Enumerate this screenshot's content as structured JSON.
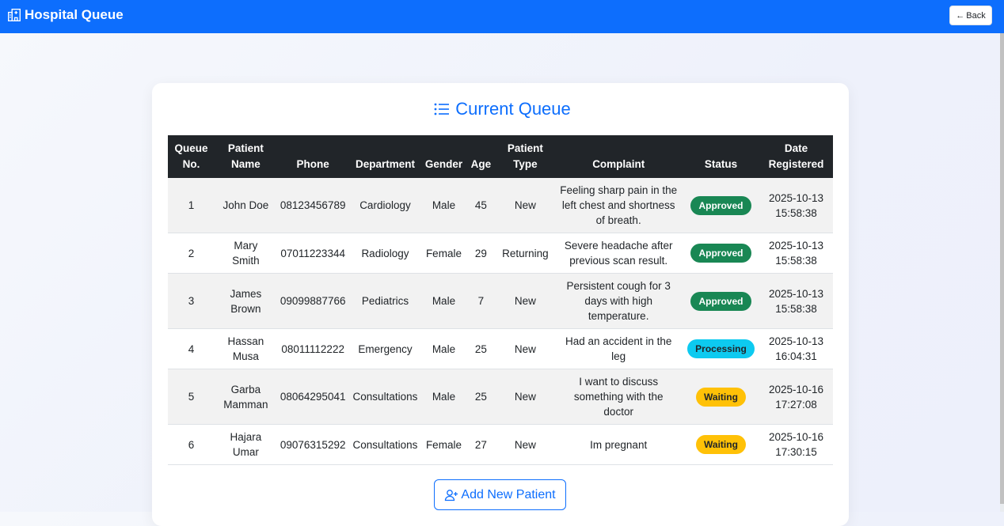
{
  "header": {
    "app_title": "Hospital Queue",
    "back_label": "Back",
    "background": "#0d6efd"
  },
  "main": {
    "title": "Current Queue",
    "add_button_label": "Add New Patient"
  },
  "table": {
    "columns": [
      [
        "Queue",
        "No."
      ],
      [
        "Patient",
        "Name"
      ],
      [
        "Phone"
      ],
      [
        "Department"
      ],
      [
        "Gender"
      ],
      [
        "Age"
      ],
      [
        "Patient",
        "Type"
      ],
      [
        "Complaint"
      ],
      [
        "Status"
      ],
      [
        "Date",
        "Registered"
      ]
    ],
    "rows": [
      {
        "queue_no": "1",
        "name": [
          "John Doe"
        ],
        "phone": "08123456789",
        "department": "Cardiology",
        "gender": "Male",
        "age": "45",
        "type": "New",
        "complaint": [
          "Feeling sharp pain in the",
          "left chest and shortness",
          "of breath."
        ],
        "status": "Approved",
        "date": "2025-10-13",
        "time": "15:58:38"
      },
      {
        "queue_no": "2",
        "name": [
          "Mary",
          "Smith"
        ],
        "phone": "07011223344",
        "department": "Radiology",
        "gender": "Female",
        "age": "29",
        "type": "Returning",
        "complaint": [
          "Severe headache after",
          "previous scan result."
        ],
        "status": "Approved",
        "date": "2025-10-13",
        "time": "15:58:38"
      },
      {
        "queue_no": "3",
        "name": [
          "James",
          "Brown"
        ],
        "phone": "09099887766",
        "department": "Pediatrics",
        "gender": "Male",
        "age": "7",
        "type": "New",
        "complaint": [
          "Persistent cough for 3",
          "days with high",
          "temperature."
        ],
        "status": "Approved",
        "date": "2025-10-13",
        "time": "15:58:38"
      },
      {
        "queue_no": "4",
        "name": [
          "Hassan",
          "Musa"
        ],
        "phone": "08011112222",
        "department": "Emergency",
        "gender": "Male",
        "age": "25",
        "type": "New",
        "complaint": [
          "Had an accident in the leg"
        ],
        "status": "Processing",
        "date": "2025-10-13",
        "time": "16:04:31"
      },
      {
        "queue_no": "5",
        "name": [
          "Garba",
          "Mamman"
        ],
        "phone": "08064295041",
        "department": "Consultations",
        "gender": "Male",
        "age": "25",
        "type": "New",
        "complaint": [
          "I want to discuss",
          "something with the doctor"
        ],
        "status": "Waiting",
        "date": "2025-10-16",
        "time": "17:27:08"
      },
      {
        "queue_no": "6",
        "name": [
          "Hajara",
          "Umar"
        ],
        "phone": "09076315292",
        "department": "Consultations",
        "gender": "Female",
        "age": "27",
        "type": "New",
        "complaint": [
          "Im pregnant"
        ],
        "status": "Waiting",
        "date": "2025-10-16",
        "time": "17:30:15"
      }
    ]
  },
  "status_colors": {
    "Approved": {
      "bg": "#198754",
      "fg": "#ffffff"
    },
    "Processing": {
      "bg": "#0dcaf0",
      "fg": "#212529"
    },
    "Waiting": {
      "bg": "#ffc107",
      "fg": "#212529"
    }
  },
  "icons": {
    "brand": "hospital-icon",
    "back": "arrow-left-icon",
    "title": "list-icon",
    "add": "person-plus-icon"
  }
}
